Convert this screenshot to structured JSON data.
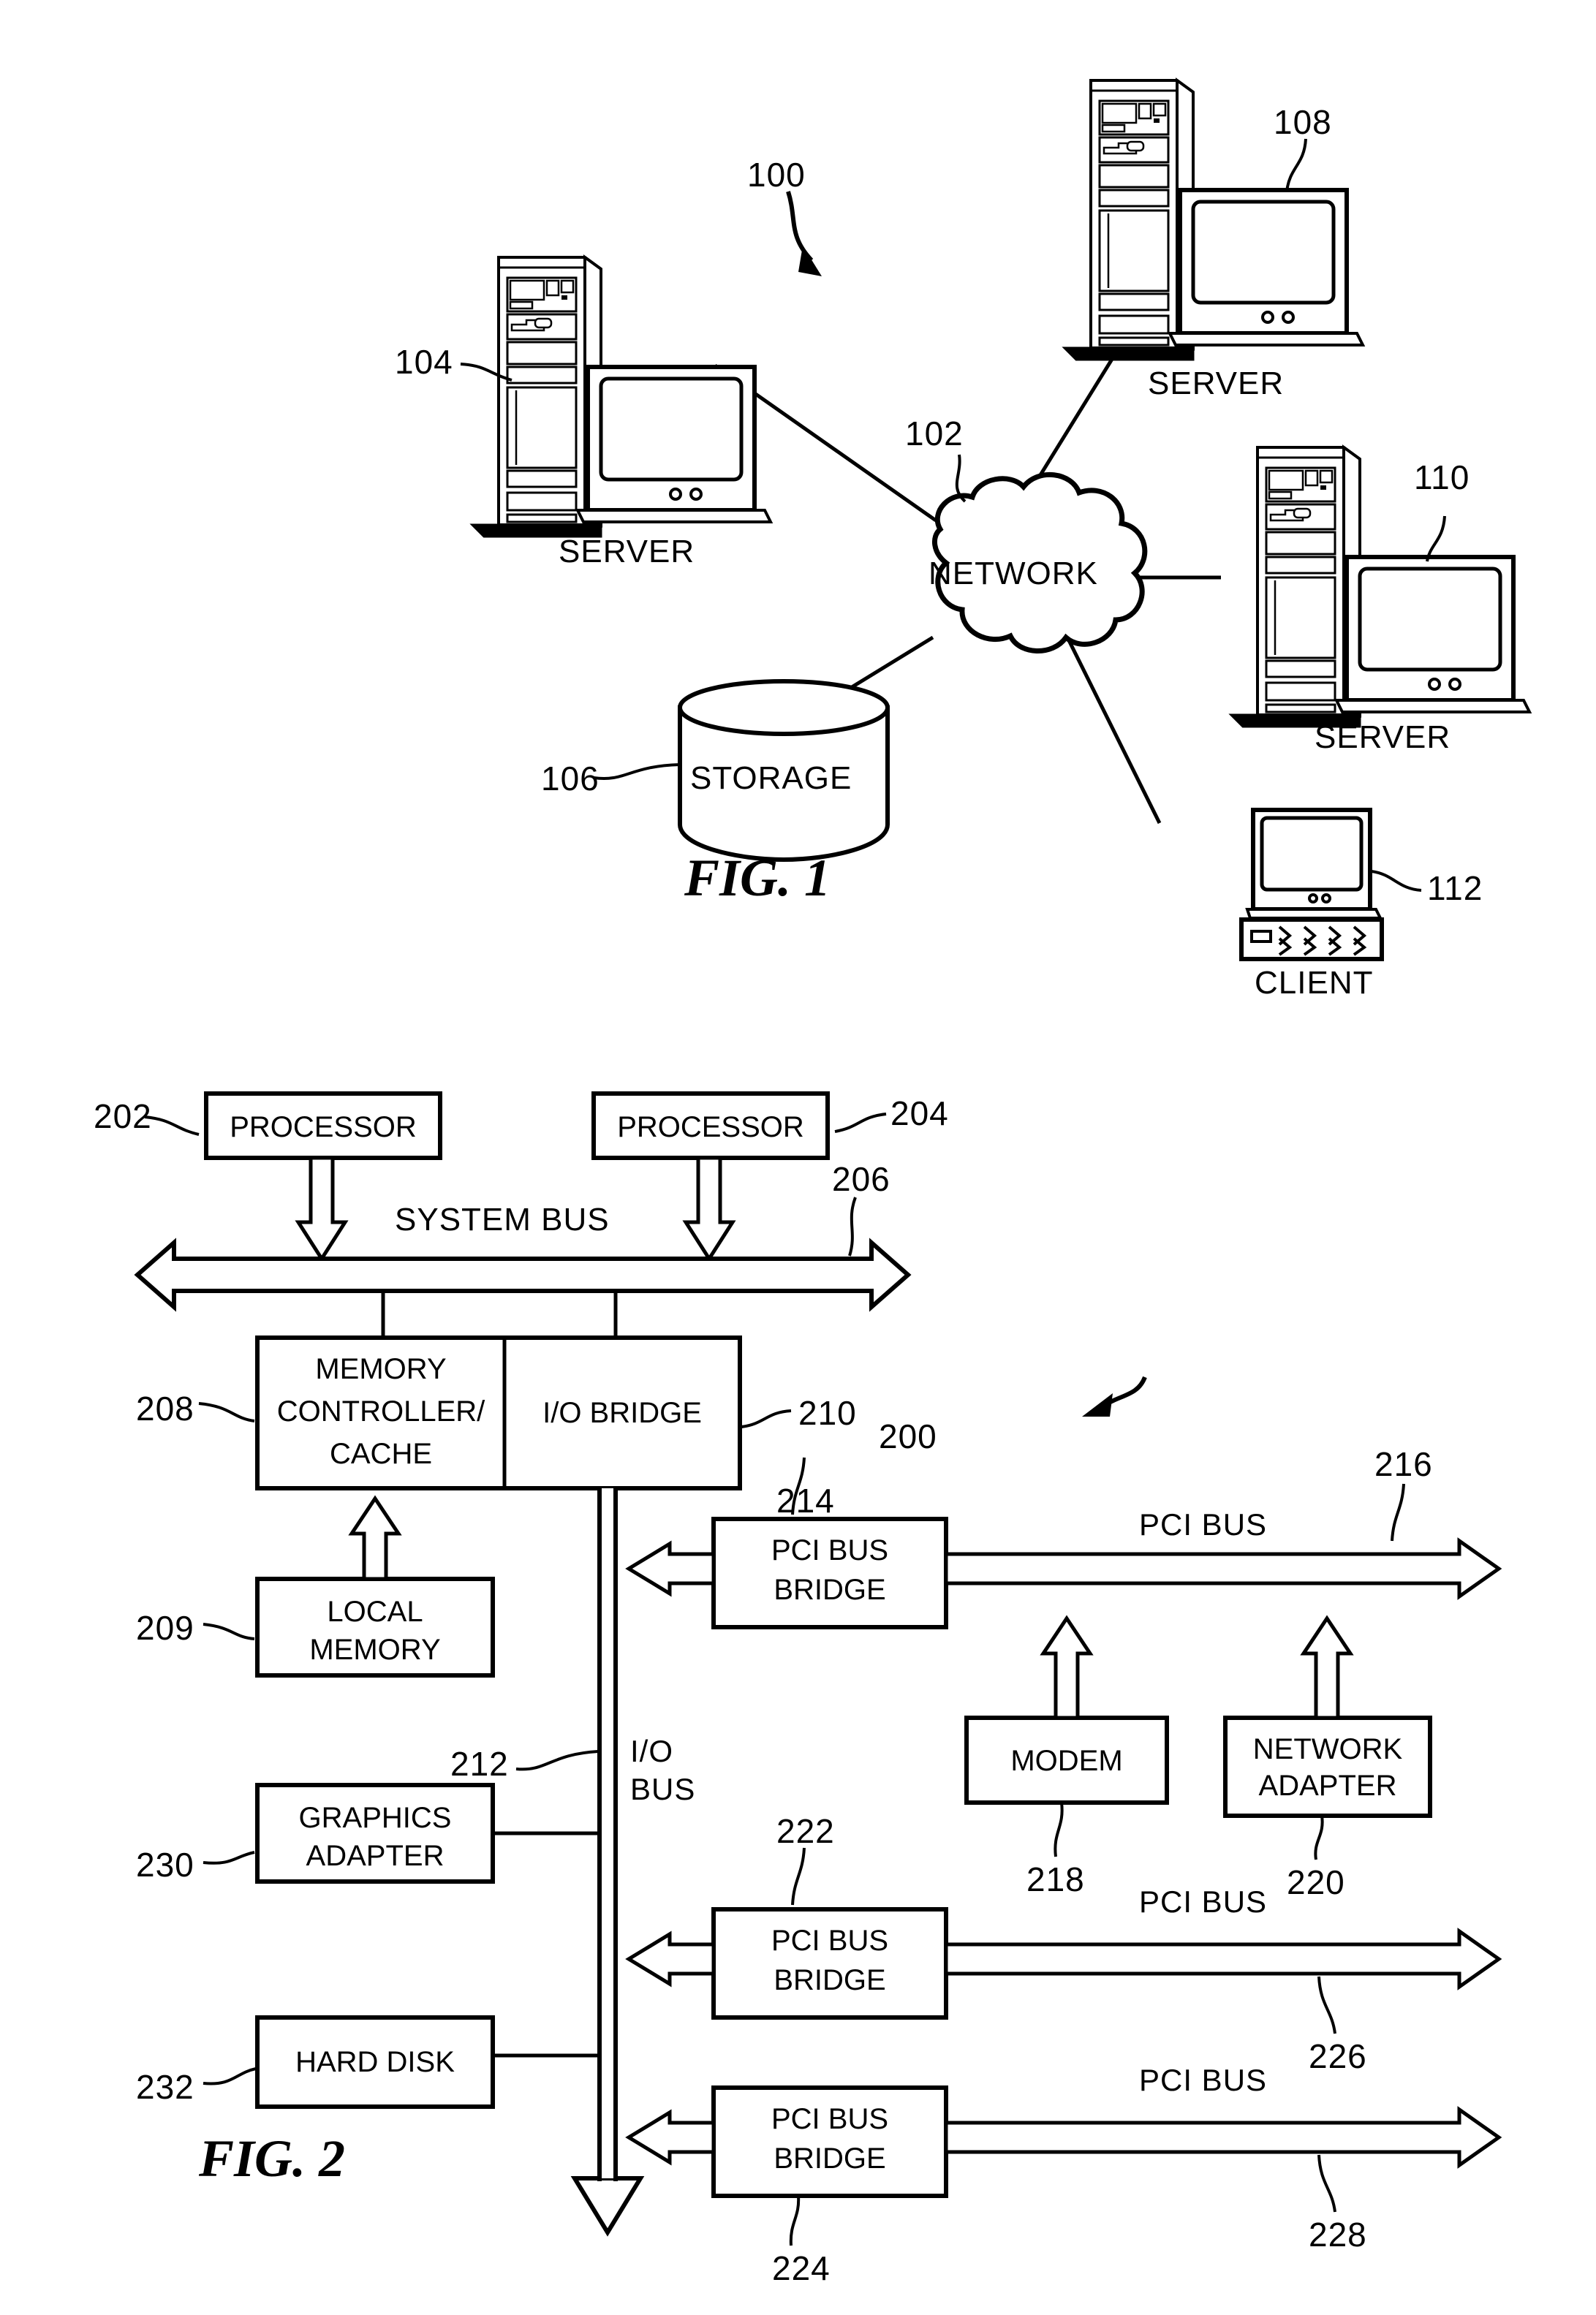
{
  "document": {
    "type": "patent-drawing-sheet",
    "figures": [
      "FIG. 1",
      "FIG. 2"
    ]
  },
  "figure1": {
    "caption": "FIG. 1",
    "system_ref": "100",
    "nodes": {
      "network": {
        "label": "NETWORK",
        "ref": "102",
        "shape": "cloud"
      },
      "server_left": {
        "label": "SERVER",
        "ref": "104",
        "shape": "tower-and-monitor"
      },
      "storage": {
        "label": "STORAGE",
        "ref": "106",
        "shape": "cylinder"
      },
      "server_top": {
        "label": "SERVER",
        "ref": "108",
        "shape": "tower-and-monitor"
      },
      "server_right": {
        "label": "SERVER",
        "ref": "110",
        "shape": "tower-and-monitor"
      },
      "client": {
        "label": "CLIENT",
        "ref": "112",
        "shape": "monitor-and-keyboard"
      }
    },
    "links": [
      {
        "from": "server_left",
        "to": "network"
      },
      {
        "from": "server_top",
        "to": "network"
      },
      {
        "from": "server_right",
        "to": "network"
      },
      {
        "from": "client",
        "to": "network"
      },
      {
        "from": "storage",
        "to": "network"
      }
    ]
  },
  "figure2": {
    "caption": "FIG. 2",
    "system_ref": "200",
    "blocks": {
      "processor_1": {
        "label": "PROCESSOR",
        "ref": "202"
      },
      "processor_2": {
        "label": "PROCESSOR",
        "ref": "204"
      },
      "memory_controller": {
        "label_line1": "MEMORY",
        "label_line2": "CONTROLLER/",
        "label_line3": "CACHE",
        "ref": "208"
      },
      "io_bridge": {
        "label": "I/O BRIDGE",
        "ref": "210"
      },
      "local_memory": {
        "label_line1": "LOCAL",
        "label_line2": "MEMORY",
        "ref": "209"
      },
      "graphics_adapter": {
        "label_line1": "GRAPHICS",
        "label_line2": "ADAPTER",
        "ref": "230"
      },
      "hard_disk": {
        "label": "HARD DISK",
        "ref": "232"
      },
      "pci_bus_bridge_1": {
        "label_line1": "PCI BUS",
        "label_line2": "BRIDGE",
        "ref": "214"
      },
      "pci_bus_bridge_2": {
        "label_line1": "PCI BUS",
        "label_line2": "BRIDGE",
        "ref": "222"
      },
      "pci_bus_bridge_3": {
        "label_line1": "PCI BUS",
        "label_line2": "BRIDGE",
        "ref": "224"
      },
      "modem": {
        "label": "MODEM",
        "ref": "218"
      },
      "network_adapter": {
        "label_line1": "NETWORK",
        "label_line2": "ADAPTER",
        "ref": "220"
      }
    },
    "buses": {
      "system_bus": {
        "label": "SYSTEM BUS",
        "ref": "206",
        "style": "double-headed-hollow-arrow"
      },
      "io_bus": {
        "label_line1": "I/O",
        "label_line2": "BUS",
        "ref": "212",
        "style": "double-line-down-arrow"
      },
      "pci_bus_1": {
        "label": "PCI BUS",
        "ref": "216",
        "style": "hollow-arrow-right"
      },
      "pci_bus_2": {
        "label": "PCI BUS",
        "ref": "226",
        "style": "hollow-arrow-right"
      },
      "pci_bus_3": {
        "label": "PCI BUS",
        "ref": "228",
        "style": "hollow-arrow-right"
      }
    }
  }
}
